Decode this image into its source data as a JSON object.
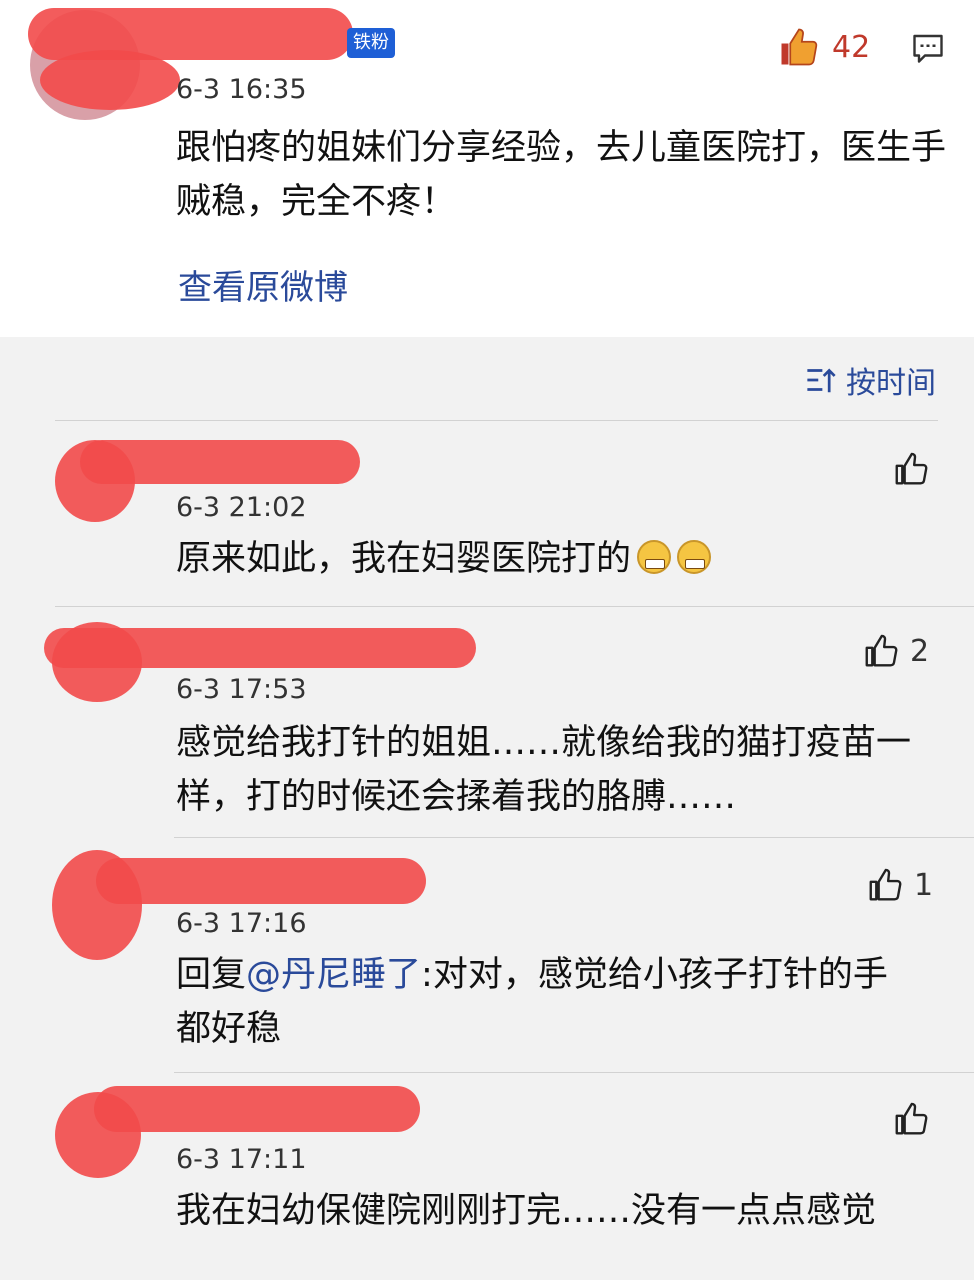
{
  "post": {
    "badge": "铁粉",
    "time": "6-3 16:35",
    "like_count": "42",
    "text": "跟怕疼的姐妹们分享经验，去儿童医院打，医生手贼稳，完全不疼！",
    "view_original": "查看原微博"
  },
  "sort": {
    "label": "按时间"
  },
  "comments": [
    {
      "time": "6-3 21:02",
      "text": "原来如此，我在妇婴医院打的",
      "likes": "",
      "emoji": "grinning-face-emoji"
    },
    {
      "time": "6-3 17:53",
      "text": "感觉给我打针的姐姐……就像给我的猫打疫苗一样，打的时候还会揉着我的胳膊……",
      "likes": "2"
    },
    {
      "time": "6-3 17:16",
      "reply_prefix": "回复",
      "mention": "@丹尼睡了",
      "text": ":对对，感觉给小孩子打针的手都好稳",
      "likes": "1"
    },
    {
      "time": "6-3 17:11",
      "text": "我在妇幼保健院刚刚打完……没有一点点感觉",
      "likes": ""
    }
  ],
  "colors": {
    "link": "#2a4a9a",
    "badge": "#1e5fd6",
    "like_active": "#e8541e",
    "like_count_active": "#c0392b"
  }
}
